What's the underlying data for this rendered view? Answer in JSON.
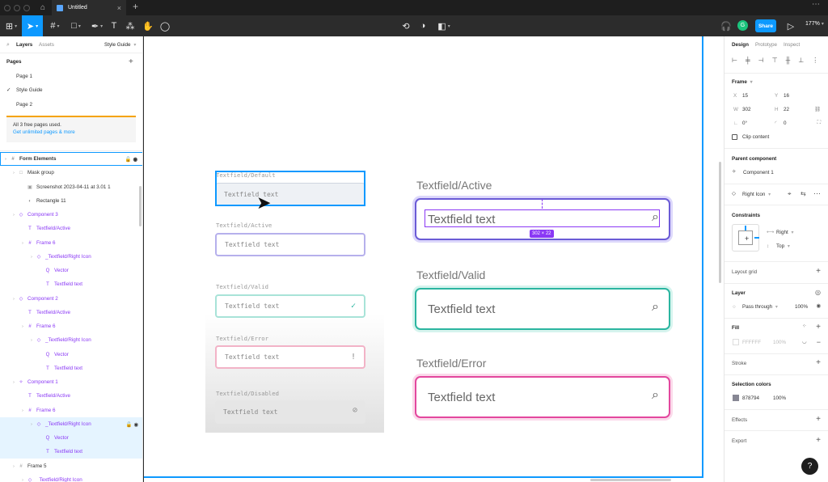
{
  "titlebar": {
    "tab_title": "Untitled",
    "more": "⋯"
  },
  "toolbar": {
    "share_label": "Share",
    "avatar": "G",
    "zoom": "177%"
  },
  "left": {
    "tabs": [
      "Layers",
      "Assets"
    ],
    "style_guide": "Style Guide",
    "pages_title": "Pages",
    "pages": [
      "Page 1",
      "Style Guide",
      "Page 2"
    ],
    "banner_text": "All 3 free pages used.",
    "banner_link": "Get unlimited pages & more",
    "layers": [
      {
        "label": "Form Elements",
        "indent": 0,
        "icon": "#",
        "purple": false,
        "bold": true
      },
      {
        "label": "Mask group",
        "indent": 1,
        "icon": "□",
        "purple": false
      },
      {
        "label": "Screenshot 2023-04-11 at 3.01 1",
        "indent": 2,
        "icon": "▣",
        "purple": false
      },
      {
        "label": "Rectangle 11",
        "indent": 2,
        "icon": "◐",
        "purple": false
      },
      {
        "label": "Component 3",
        "indent": 1,
        "icon": "◇",
        "purple": true
      },
      {
        "label": "Textfield/Active",
        "indent": 2,
        "icon": "T",
        "purple": true
      },
      {
        "label": "Frame 6",
        "indent": 2,
        "icon": "#",
        "purple": true
      },
      {
        "label": "_Textfield/Right Icon",
        "indent": 3,
        "icon": "◇",
        "purple": true
      },
      {
        "label": "Vector",
        "indent": 4,
        "icon": "Q",
        "purple": true
      },
      {
        "label": "Textfield text",
        "indent": 4,
        "icon": "T",
        "purple": true
      },
      {
        "label": "Component 2",
        "indent": 1,
        "icon": "◇",
        "purple": true
      },
      {
        "label": "Textfield/Active",
        "indent": 2,
        "icon": "T",
        "purple": true
      },
      {
        "label": "Frame 6",
        "indent": 2,
        "icon": "#",
        "purple": true
      },
      {
        "label": "_Textfield/Right Icon",
        "indent": 3,
        "icon": "◇",
        "purple": true
      },
      {
        "label": "Vector",
        "indent": 4,
        "icon": "Q",
        "purple": true
      },
      {
        "label": "Textfield text",
        "indent": 4,
        "icon": "T",
        "purple": true
      },
      {
        "label": "Component 1",
        "indent": 1,
        "icon": "✧",
        "purple": true
      },
      {
        "label": "Textfield/Active",
        "indent": 2,
        "icon": "T",
        "purple": true
      },
      {
        "label": "Frame 6",
        "indent": 2,
        "icon": "#",
        "purple": true
      },
      {
        "label": "_Textfield/Right Icon",
        "indent": 3,
        "icon": "◇",
        "purple": true,
        "selected": true
      },
      {
        "label": "Vector",
        "indent": 4,
        "icon": "Q",
        "purple": true,
        "selected": true
      },
      {
        "label": "Textfield text",
        "indent": 4,
        "icon": "T",
        "purple": true,
        "selected": true
      },
      {
        "label": "Frame 5",
        "indent": 1,
        "icon": "#",
        "purple": false
      },
      {
        "label": "_Textfield/Right Icon",
        "indent": 2,
        "icon": "◇",
        "purple": true
      }
    ]
  },
  "canvas": {
    "screenshot_labels": [
      "Textfield/Default",
      "Textfield/Active",
      "Textfield/Valid",
      "Textfield/Error",
      "Textfield/Disabled"
    ],
    "screenshot_placeholder": "Textfield text",
    "labels": [
      "Textfield/Active",
      "Textfield/Valid",
      "Textfield/Error"
    ],
    "field_text": "Textfield text",
    "size_badge": "302 × 22"
  },
  "right": {
    "tabs": [
      "Design",
      "Prototype",
      "Inspect"
    ],
    "frame_title": "Frame",
    "x_label": "X",
    "x": "15",
    "y_label": "Y",
    "y": "16",
    "w_label": "W",
    "w": "302",
    "h_label": "H",
    "h": "22",
    "rotation": "0°",
    "radius": "0",
    "clip_content": "Clip content",
    "parent_component": "Parent component",
    "component_name": "Component 1",
    "right_icon": "Right Icon",
    "constraints": "Constraints",
    "constraint_h": "Right",
    "constraint_v": "Top",
    "layout_grid": "Layout grid",
    "layer": "Layer",
    "blend": "Pass through",
    "opacity": "100%",
    "fill": "Fill",
    "fill_hex": "FFFFFF",
    "fill_opacity": "100%",
    "stroke": "Stroke",
    "selection_colors": "Selection colors",
    "sel_hex": "878794",
    "sel_opacity": "100%",
    "effects": "Effects",
    "export": "Export"
  },
  "help": "?",
  "colors": {
    "accent": "#0d99ff",
    "purple": "#8a38f5",
    "valid": "#2bb5a0",
    "error": "#e3479e",
    "active": "#6b5bd6"
  }
}
